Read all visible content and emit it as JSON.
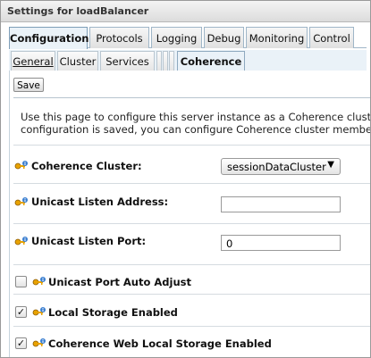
{
  "window": {
    "title": "Settings for loadBalancer"
  },
  "tabs": [
    {
      "label": "Configuration"
    },
    {
      "label": "Protocols"
    },
    {
      "label": "Logging"
    },
    {
      "label": "Debug"
    },
    {
      "label": "Monitoring"
    },
    {
      "label": "Control"
    }
  ],
  "subtabs": [
    {
      "label": "General"
    },
    {
      "label": "Cluster"
    },
    {
      "label": "Services"
    },
    {
      "label": "Coherence"
    }
  ],
  "toolbar": {
    "save_label": "Save"
  },
  "description": {
    "line1": "Use this page to configure this server instance as a Coherence cluster member",
    "line2": "configuration is saved, you can configure Coherence cluster member properties"
  },
  "fields": {
    "coherence_cluster": {
      "label": "Coherence Cluster:",
      "value": "sessionDataCluster"
    },
    "unicast_listen_address": {
      "label": "Unicast Listen Address:",
      "value": ""
    },
    "unicast_listen_port": {
      "label": "Unicast Listen Port:",
      "value": "0"
    },
    "unicast_port_auto_adjust": {
      "label": "Unicast Port Auto Adjust",
      "checked": false
    },
    "local_storage_enabled": {
      "label": "Local Storage Enabled",
      "checked": true
    },
    "coherence_web_local_storage_enabled": {
      "label": "Coherence Web Local Storage Enabled",
      "checked": true
    }
  },
  "icons": {
    "field_info": "key-info-icon",
    "dropdown": "dropdown-arrow-icon"
  },
  "colors": {
    "tab_active_bg": "#eaf2f8",
    "tab_border": "#9fb6c8",
    "divider": "#b7c4cf"
  }
}
